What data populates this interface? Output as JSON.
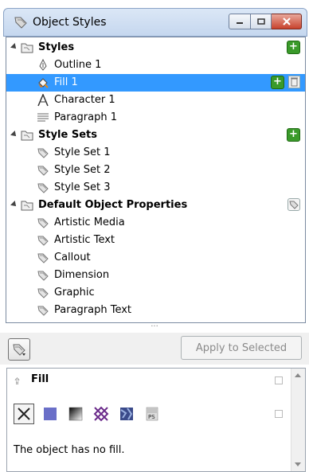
{
  "window": {
    "title": "Object Styles",
    "buttons": {
      "minimize": "minimize-icon",
      "maximize": "maximize-icon",
      "close": "close-icon"
    }
  },
  "tree": {
    "styles": {
      "label": "Styles",
      "items": [
        {
          "label": "Outline 1",
          "icon": "pen-nib-icon"
        },
        {
          "label": "Fill 1",
          "icon": "paint-bucket-icon",
          "selected": true
        },
        {
          "label": "Character 1",
          "icon": "character-a-icon"
        },
        {
          "label": "Paragraph 1",
          "icon": "paragraph-lines-icon"
        }
      ]
    },
    "style_sets": {
      "label": "Style Sets",
      "items": [
        {
          "label": "Style Set 1"
        },
        {
          "label": "Style Set 2"
        },
        {
          "label": "Style Set 3"
        }
      ]
    },
    "defaults": {
      "label": "Default Object Properties",
      "items": [
        {
          "label": "Artistic Media"
        },
        {
          "label": "Artistic Text"
        },
        {
          "label": "Callout"
        },
        {
          "label": "Dimension"
        },
        {
          "label": "Graphic"
        },
        {
          "label": "Paragraph Text"
        }
      ]
    }
  },
  "toolbar": {
    "apply_label": "Apply to Selected"
  },
  "properties": {
    "section_title": "Fill",
    "fill_types": [
      "no-fill-icon",
      "uniform-fill-icon",
      "fountain-fill-icon",
      "pattern-fill-icon",
      "texture-fill-icon",
      "postscript-fill-icon"
    ],
    "description": "The object has no fill."
  },
  "colors": {
    "selection": "#3399ff",
    "add_green": "#3a9a2a",
    "uniform_fill": "#6a6fc8"
  }
}
